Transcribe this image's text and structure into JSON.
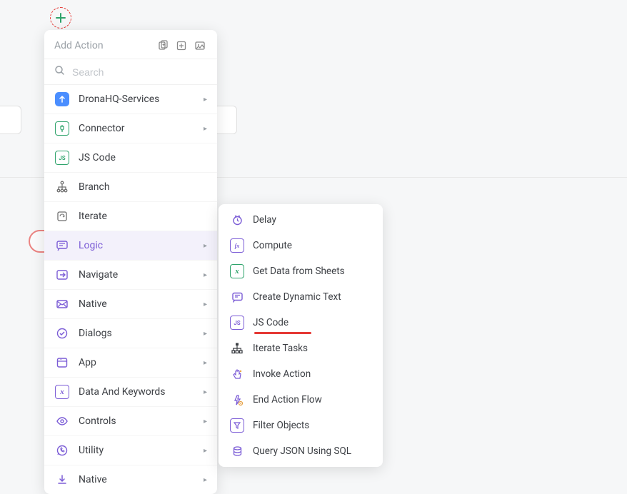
{
  "panel": {
    "title": "Add Action",
    "search_placeholder": "Search"
  },
  "menu": [
    {
      "id": "dronahq",
      "label": "DronaHQ-Services",
      "icon": "dronahq-icon",
      "chevron": true,
      "color": "#4a8eff"
    },
    {
      "id": "connector",
      "label": "Connector",
      "icon": "plug-icon",
      "chevron": true,
      "color": "#2ea36b"
    },
    {
      "id": "jscode",
      "label": "JS Code",
      "icon": "js-icon",
      "chevron": false,
      "color": "#2ea36b"
    },
    {
      "id": "branch",
      "label": "Branch",
      "icon": "branch-icon",
      "chevron": false,
      "color": "#6e6e6e"
    },
    {
      "id": "iterate",
      "label": "Iterate",
      "icon": "iterate-icon",
      "chevron": false,
      "color": "#6e6e6e"
    },
    {
      "id": "logic",
      "label": "Logic",
      "icon": "logic-icon",
      "chevron": true,
      "color": "#7b5cd6",
      "selected": true
    },
    {
      "id": "navigate",
      "label": "Navigate",
      "icon": "navigate-icon",
      "chevron": true,
      "color": "#7b5cd6"
    },
    {
      "id": "native1",
      "label": "Native",
      "icon": "mail-icon",
      "chevron": true,
      "color": "#7b5cd6"
    },
    {
      "id": "dialogs",
      "label": "Dialogs",
      "icon": "check-circle-icon",
      "chevron": true,
      "color": "#7b5cd6"
    },
    {
      "id": "app",
      "label": "App",
      "icon": "app-icon",
      "chevron": true,
      "color": "#7b5cd6"
    },
    {
      "id": "datakeywords",
      "label": "Data And Keywords",
      "icon": "data-icon",
      "chevron": true,
      "color": "#7b5cd6"
    },
    {
      "id": "controls",
      "label": "Controls",
      "icon": "eye-icon",
      "chevron": true,
      "color": "#7b5cd6"
    },
    {
      "id": "utility",
      "label": "Utility",
      "icon": "whatsapp-icon",
      "chevron": true,
      "color": "#7b5cd6"
    },
    {
      "id": "native2",
      "label": "Native",
      "icon": "download-icon",
      "chevron": true,
      "color": "#7b5cd6"
    }
  ],
  "submenu": [
    {
      "id": "delay",
      "label": "Delay",
      "icon": "clock-icon"
    },
    {
      "id": "compute",
      "label": "Compute",
      "icon": "fx-icon"
    },
    {
      "id": "getdata",
      "label": "Get Data from Sheets",
      "icon": "sheet-icon"
    },
    {
      "id": "dyntext",
      "label": "Create Dynamic Text",
      "icon": "text-icon"
    },
    {
      "id": "jscode",
      "label": "JS Code",
      "icon": "js-icon"
    },
    {
      "id": "iteratetasks",
      "label": "Iterate Tasks",
      "icon": "tree-icon",
      "highlight": true
    },
    {
      "id": "invoke",
      "label": "Invoke Action",
      "icon": "hand-icon"
    },
    {
      "id": "endflow",
      "label": "End Action Flow",
      "icon": "bolt-icon"
    },
    {
      "id": "filter",
      "label": "Filter Objects",
      "icon": "filter-icon"
    },
    {
      "id": "querysql",
      "label": "Query JSON Using SQL",
      "icon": "db-icon"
    }
  ],
  "colors": {
    "accent": "#7b5cd6",
    "danger": "#e53935",
    "green": "#2ea36b",
    "blue": "#4a8eff"
  }
}
